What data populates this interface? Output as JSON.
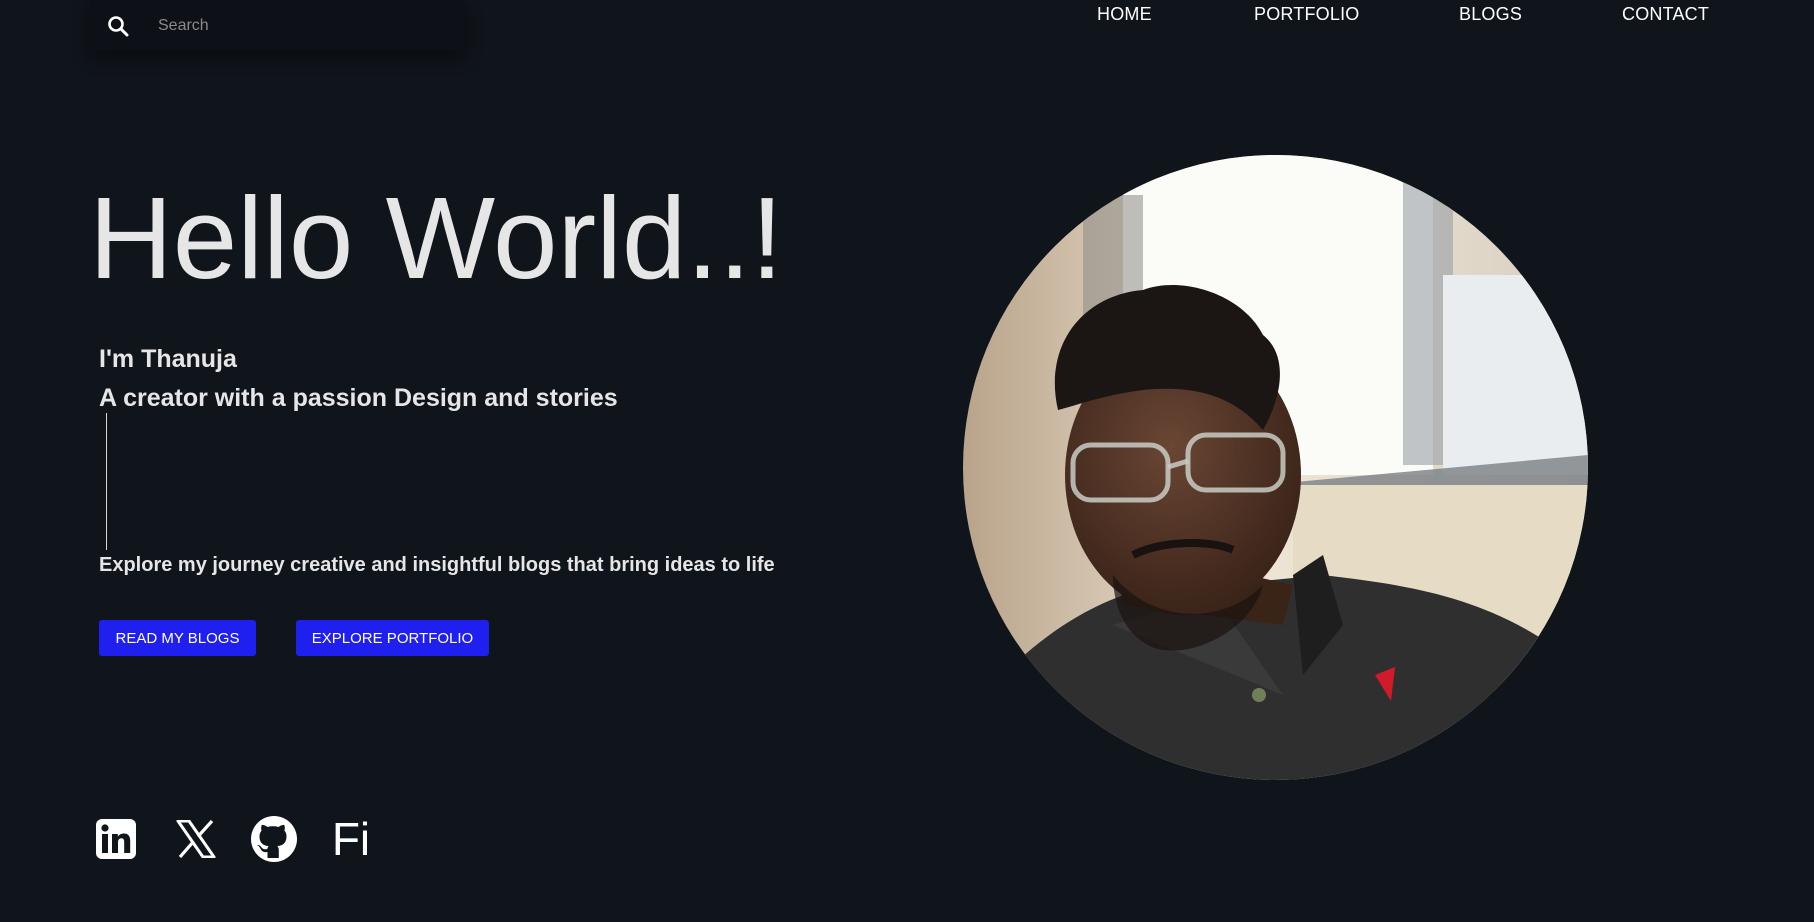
{
  "search": {
    "placeholder": "Search",
    "value": ""
  },
  "nav": {
    "items": [
      "HOME",
      "PORTFOLIO",
      "BLOGS",
      "CONTACT"
    ]
  },
  "hero": {
    "title": "Hello World..!",
    "intro_line1": "I'm Thanuja",
    "intro_line2": "A creator with a passion Design and stories",
    "tagline": "Explore my journey creative and insightful blogs that bring ideas to life"
  },
  "buttons": {
    "primary": "READ MY BLOGS",
    "secondary": "EXPLORE PORTFOLIO"
  },
  "social": {
    "icons": [
      "linkedin-icon",
      "x-twitter-icon",
      "github-icon",
      "figma-icon"
    ],
    "figma_label": "Fi"
  },
  "colors": {
    "background": "#10141b",
    "accent": "#1f1ff0",
    "text": "#e6e6e6"
  }
}
